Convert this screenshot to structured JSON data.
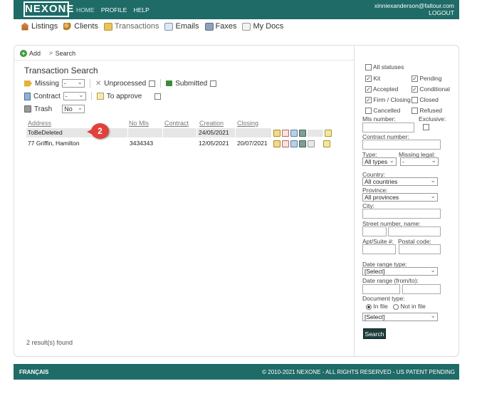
{
  "brand": {
    "logo": "NEXONE",
    "color": "#1f6b67"
  },
  "top_nav": {
    "home": "HOME",
    "profile": "PROFILE",
    "help": "HELP"
  },
  "user": {
    "email": "xinniexanderson@faltour.com",
    "logout": "LOGOUT"
  },
  "sub_nav": [
    {
      "label": "Listings",
      "icon": "house-icon"
    },
    {
      "label": "Clients",
      "icon": "people-icon"
    },
    {
      "label": "Transactions",
      "icon": "folder-icon"
    },
    {
      "label": "Emails",
      "icon": "envelope-icon"
    },
    {
      "label": "Faxes",
      "icon": "printer-icon"
    },
    {
      "label": "My Docs",
      "icon": "document-icon"
    }
  ],
  "toolbar": {
    "add": "Add",
    "search": "Search"
  },
  "page_title": "Transaction Search",
  "filters": {
    "missing_label": "Missing",
    "missing_value": "-",
    "unprocessed_label": "Unprocessed",
    "submitted_label": "Submitted",
    "contract_label": "Contract",
    "contract_value": "-",
    "to_approve_label": "To approve",
    "trash_label": "Trash",
    "trash_value": "No"
  },
  "table": {
    "headers": [
      "Address",
      "No Mls",
      "Contract",
      "Creation",
      "Closing"
    ],
    "rows": [
      {
        "address": "ToBeDeleted",
        "no_mls": "",
        "contract": "",
        "creation": "24/05/2021",
        "closing": ""
      },
      {
        "address": "77 Griffin, Hamilton",
        "no_mls": "3434343",
        "contract": "",
        "creation": "12/05/2021",
        "closing": "20/07/2021"
      }
    ]
  },
  "callout": {
    "number": "2"
  },
  "results_text": "2 result(s) found",
  "side": {
    "all_statuses": "All statuses",
    "statuses": [
      {
        "label": "Kit",
        "checked": true
      },
      {
        "label": "Pending",
        "checked": true
      },
      {
        "label": "Accepted",
        "checked": true
      },
      {
        "label": "Conditional",
        "checked": true
      },
      {
        "label": "Firm / Closing",
        "checked": true
      },
      {
        "label": "Closed",
        "checked": false
      },
      {
        "label": "Cancelled",
        "checked": false
      },
      {
        "label": "Refused",
        "checked": false
      }
    ],
    "mls_number": "Mls number:",
    "exclusive": "Exclusive:",
    "contract_number": "Contract number:",
    "type_label": "Type:",
    "type_value": "All types",
    "missing_legal_label": "Missing legal:",
    "missing_legal_value": "-",
    "country_label": "Country:",
    "country_value": "All countries",
    "province_label": "Province:",
    "province_value": "All provinces",
    "city_label": "City:",
    "street_label": "Street number, name:",
    "apt_label": "Apt/Suite #:",
    "postal_label": "Postal code:",
    "date_range_type_label": "Date range type:",
    "date_range_type_value": "[Select]",
    "date_range_label": "Date range (from/to):",
    "doc_type_label": "Document type:",
    "in_file": "In file",
    "not_in_file": "Not in file",
    "doc_type_value": "[Select]",
    "search_button": "Search"
  },
  "footer": {
    "language": "FRANÇAIS",
    "copyright": "© 2010-2021 NEXONE - ALL RIGHTS RESERVED - US PATENT PENDING"
  }
}
